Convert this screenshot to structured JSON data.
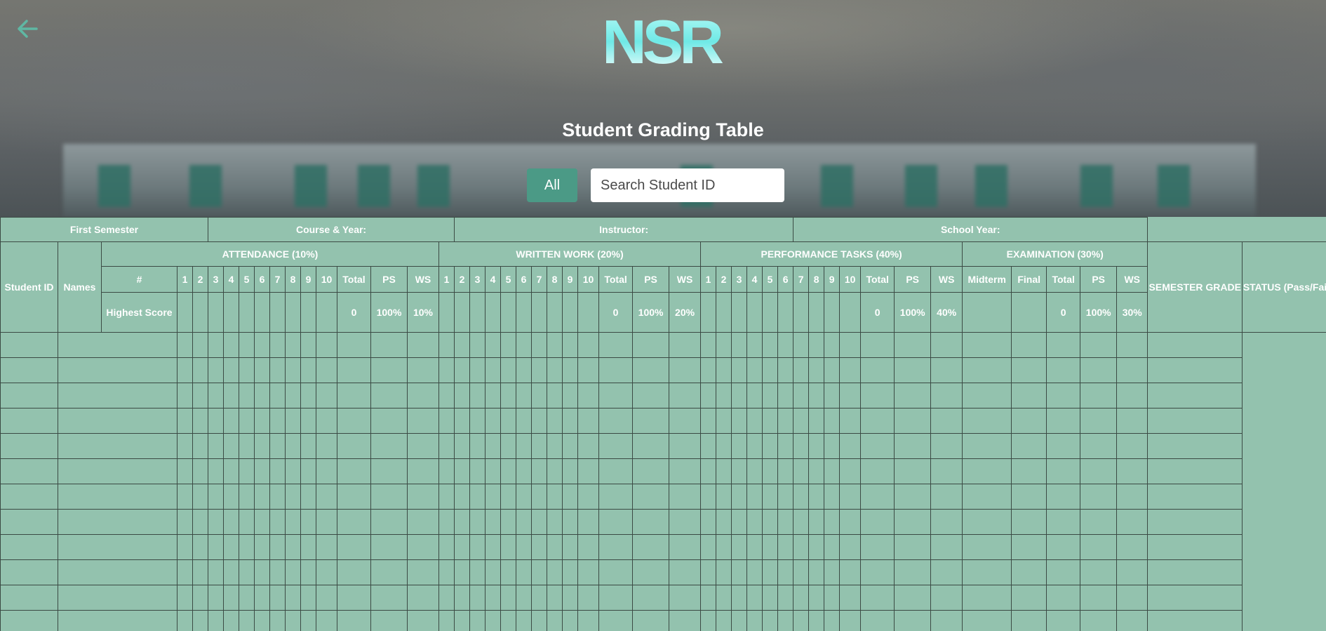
{
  "page": {
    "title": "Student Grading Table",
    "logo_text": "NSR",
    "filter_button": "All",
    "search_placeholder": "Search Student ID",
    "colors": {
      "accent": "#4b9a86",
      "table_bg": "#93c2ae",
      "logo": "#7ff0ee"
    }
  },
  "info_row": {
    "semester": "First Semester",
    "course_year": "Course & Year:",
    "instructor": "Instructor:",
    "school_year": "School Year:"
  },
  "headers": {
    "student_id": "Student ID",
    "names": "Names",
    "attendance": "ATTENDANCE (10%)",
    "written": "WRITTEN WORK (20%)",
    "performance": "PERFORMANCE TASKS (40%)",
    "examination": "EXAMINATION (30%)",
    "semester_grade": "SEMESTER GRADE",
    "status": "STATUS (Pass/Fail)",
    "hash": "#",
    "highest_score": "Highest Score",
    "total": "Total",
    "ps": "PS",
    "ws": "WS",
    "midterm": "Midterm",
    "final": "Final",
    "numbers": [
      "1",
      "2",
      "3",
      "4",
      "5",
      "6",
      "7",
      "8",
      "9",
      "10"
    ]
  },
  "highest": {
    "attendance": {
      "total": "0",
      "ps": "100%",
      "ws": "10%"
    },
    "written": {
      "total": "0",
      "ps": "100%",
      "ws": "20%"
    },
    "performance": {
      "total": "0",
      "ps": "100%",
      "ws": "40%"
    },
    "examination": {
      "total": "0",
      "ps": "100%",
      "ws": "30%"
    }
  }
}
